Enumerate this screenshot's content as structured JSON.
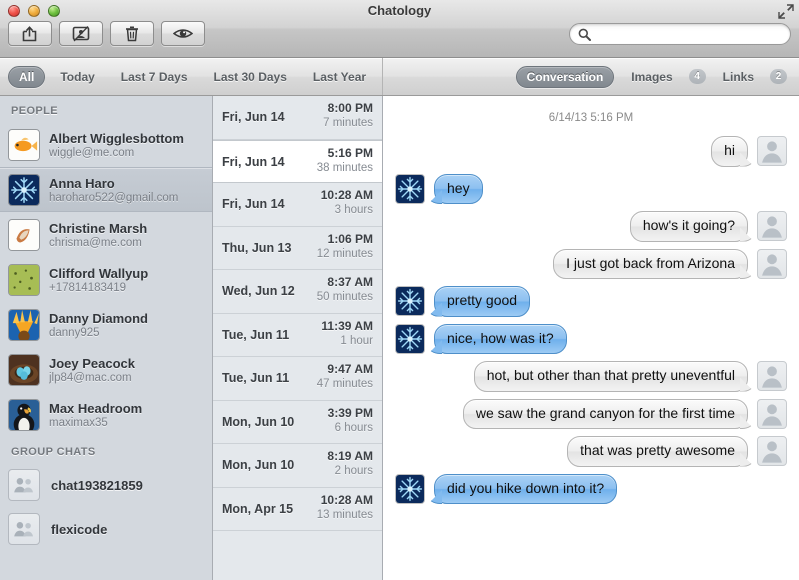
{
  "window": {
    "title": "Chatology",
    "traffic_lights": [
      "close",
      "minimize",
      "zoom"
    ],
    "fullscreen_label": "Enter Full Screen"
  },
  "toolbar": {
    "buttons": [
      {
        "name": "share-button",
        "icon": "share-icon",
        "label": "Share"
      },
      {
        "name": "export-button",
        "icon": "transcript-icon",
        "label": "Export Transcript"
      },
      {
        "name": "delete-button",
        "icon": "trash-icon",
        "label": "Delete"
      },
      {
        "name": "quicklook-button",
        "icon": "eye-icon",
        "label": "Quick Look"
      }
    ],
    "search": {
      "value": "",
      "placeholder": ""
    }
  },
  "filters": {
    "date_filters": [
      {
        "label": "All",
        "selected": true
      },
      {
        "label": "Today",
        "selected": false
      },
      {
        "label": "Last 7 Days",
        "selected": false
      },
      {
        "label": "Last 30 Days",
        "selected": false
      },
      {
        "label": "Last Year",
        "selected": false
      }
    ],
    "view_tabs": [
      {
        "label": "Conversation",
        "badge": "",
        "selected": true
      },
      {
        "label": "Images",
        "badge": "4",
        "selected": false
      },
      {
        "label": "Links",
        "badge": "2",
        "selected": false
      }
    ]
  },
  "sidebar": {
    "people_header": "PEOPLE",
    "people": [
      {
        "name": "Albert Wigglesbottom",
        "sub": "wiggle@me.com",
        "avatar": "goldfish",
        "selected": false
      },
      {
        "name": "Anna Haro",
        "sub": "haroharo522@gmail.com",
        "avatar": "snowflake",
        "selected": true
      },
      {
        "name": "Christine Marsh",
        "sub": "chrisma@me.com",
        "avatar": "shell",
        "selected": false
      },
      {
        "name": "Clifford Wallyup",
        "sub": "+17814183419",
        "avatar": "leaf",
        "selected": false
      },
      {
        "name": "Danny Diamond",
        "sub": "danny925",
        "avatar": "sunflower",
        "selected": false
      },
      {
        "name": "Joey Peacock",
        "sub": "jlp84@mac.com",
        "avatar": "eggs",
        "selected": false
      },
      {
        "name": "Max Headroom",
        "sub": "maximax35",
        "avatar": "penguin",
        "selected": false
      }
    ],
    "groups_header": "GROUP CHATS",
    "groups": [
      {
        "name": "chat193821859"
      },
      {
        "name": "flexicode"
      }
    ]
  },
  "conversations": [
    {
      "date": "Fri, Jun 14",
      "time": "8:00 PM",
      "duration": "7 minutes",
      "selected": false
    },
    {
      "date": "Fri, Jun 14",
      "time": "5:16 PM",
      "duration": "38 minutes",
      "selected": true
    },
    {
      "date": "Fri, Jun 14",
      "time": "10:28 AM",
      "duration": "3 hours",
      "selected": false
    },
    {
      "date": "Thu, Jun 13",
      "time": "1:06 PM",
      "duration": "12 minutes",
      "selected": false
    },
    {
      "date": "Wed, Jun 12",
      "time": "8:37 AM",
      "duration": "50 minutes",
      "selected": false
    },
    {
      "date": "Tue, Jun 11",
      "time": "11:39 AM",
      "duration": "1 hour",
      "selected": false
    },
    {
      "date": "Tue, Jun 11",
      "time": "9:47 AM",
      "duration": "47 minutes",
      "selected": false
    },
    {
      "date": "Mon, Jun 10",
      "time": "3:39 PM",
      "duration": "6 hours",
      "selected": false
    },
    {
      "date": "Mon, Jun 10",
      "time": "8:19 AM",
      "duration": "2 hours",
      "selected": false
    },
    {
      "date": "Mon, Apr 15",
      "time": "10:28 AM",
      "duration": "13 minutes",
      "selected": false
    }
  ],
  "chat": {
    "timestamp": "6/14/13 5:16 PM",
    "messages": [
      {
        "text": "hi",
        "side": "outgoing",
        "avatar": "placeholder"
      },
      {
        "text": "hey",
        "side": "incoming",
        "avatar": "snowflake"
      },
      {
        "text": "how's it going?",
        "side": "outgoing",
        "avatar": "placeholder"
      },
      {
        "text": "I just got back from Arizona",
        "side": "outgoing",
        "avatar": "placeholder"
      },
      {
        "text": "pretty good",
        "side": "incoming",
        "avatar": "snowflake"
      },
      {
        "text": "nice, how was it?",
        "side": "incoming",
        "avatar": "snowflake"
      },
      {
        "text": "hot, but other than that pretty uneventful",
        "side": "outgoing",
        "avatar": "placeholder"
      },
      {
        "text": "we saw the grand canyon for the first time",
        "side": "outgoing",
        "avatar": "placeholder"
      },
      {
        "text": "that was pretty awesome",
        "side": "outgoing",
        "avatar": "placeholder"
      },
      {
        "text": "did you hike down into it?",
        "side": "incoming",
        "avatar": "snowflake"
      }
    ]
  },
  "colors": {
    "accent_blue": "#8dc0f0",
    "selected_pill": "#81888f",
    "sidebar_bg": "#d3d8de",
    "convlist_bg": "#e4e8ec"
  }
}
